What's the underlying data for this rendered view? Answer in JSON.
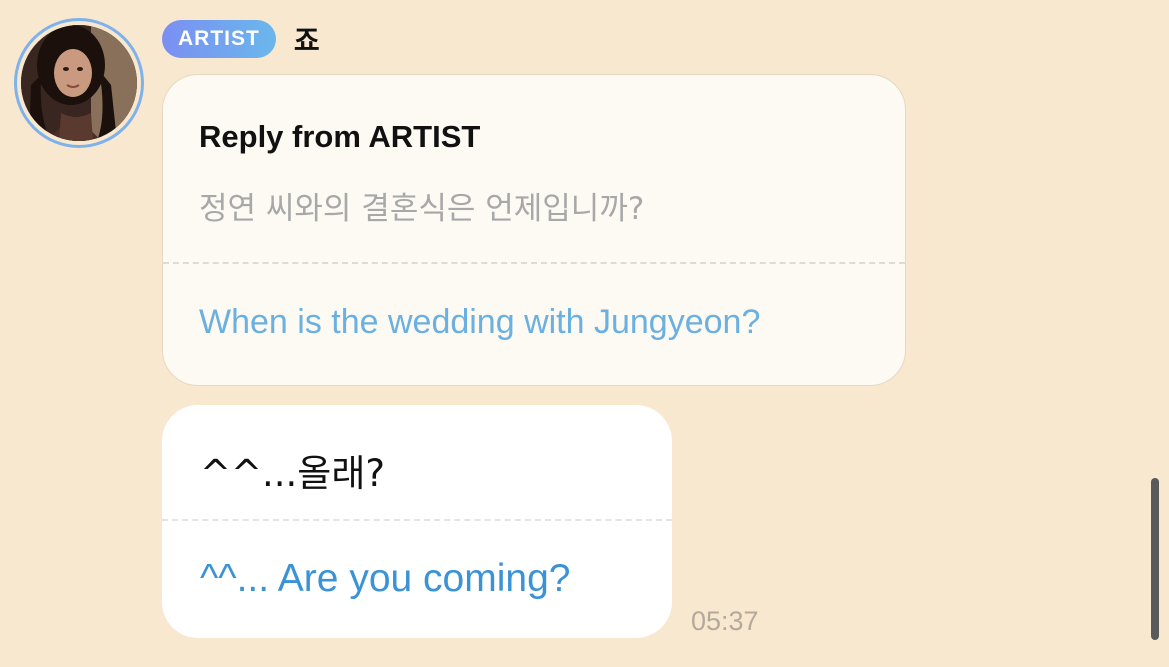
{
  "message": {
    "badge": "ARTIST",
    "sender": "죠",
    "reply": {
      "title": "Reply from ARTIST",
      "original_korean": "정연 씨와의 결혼식은 언제입니까?",
      "original_translation": "When is the wedding with Jungyeon?"
    },
    "body_korean": "^^...올래?",
    "body_translation": "^^... Are you coming?",
    "time": "05:37"
  },
  "colors": {
    "background": "#f7e8cf",
    "badge_gradient_start": "#7b8ff2",
    "badge_gradient_end": "#6ab7ec",
    "translation_blue": "#3b93d6",
    "reply_translation_blue": "#6ab0e0",
    "avatar_ring": "#7fb2ea"
  }
}
